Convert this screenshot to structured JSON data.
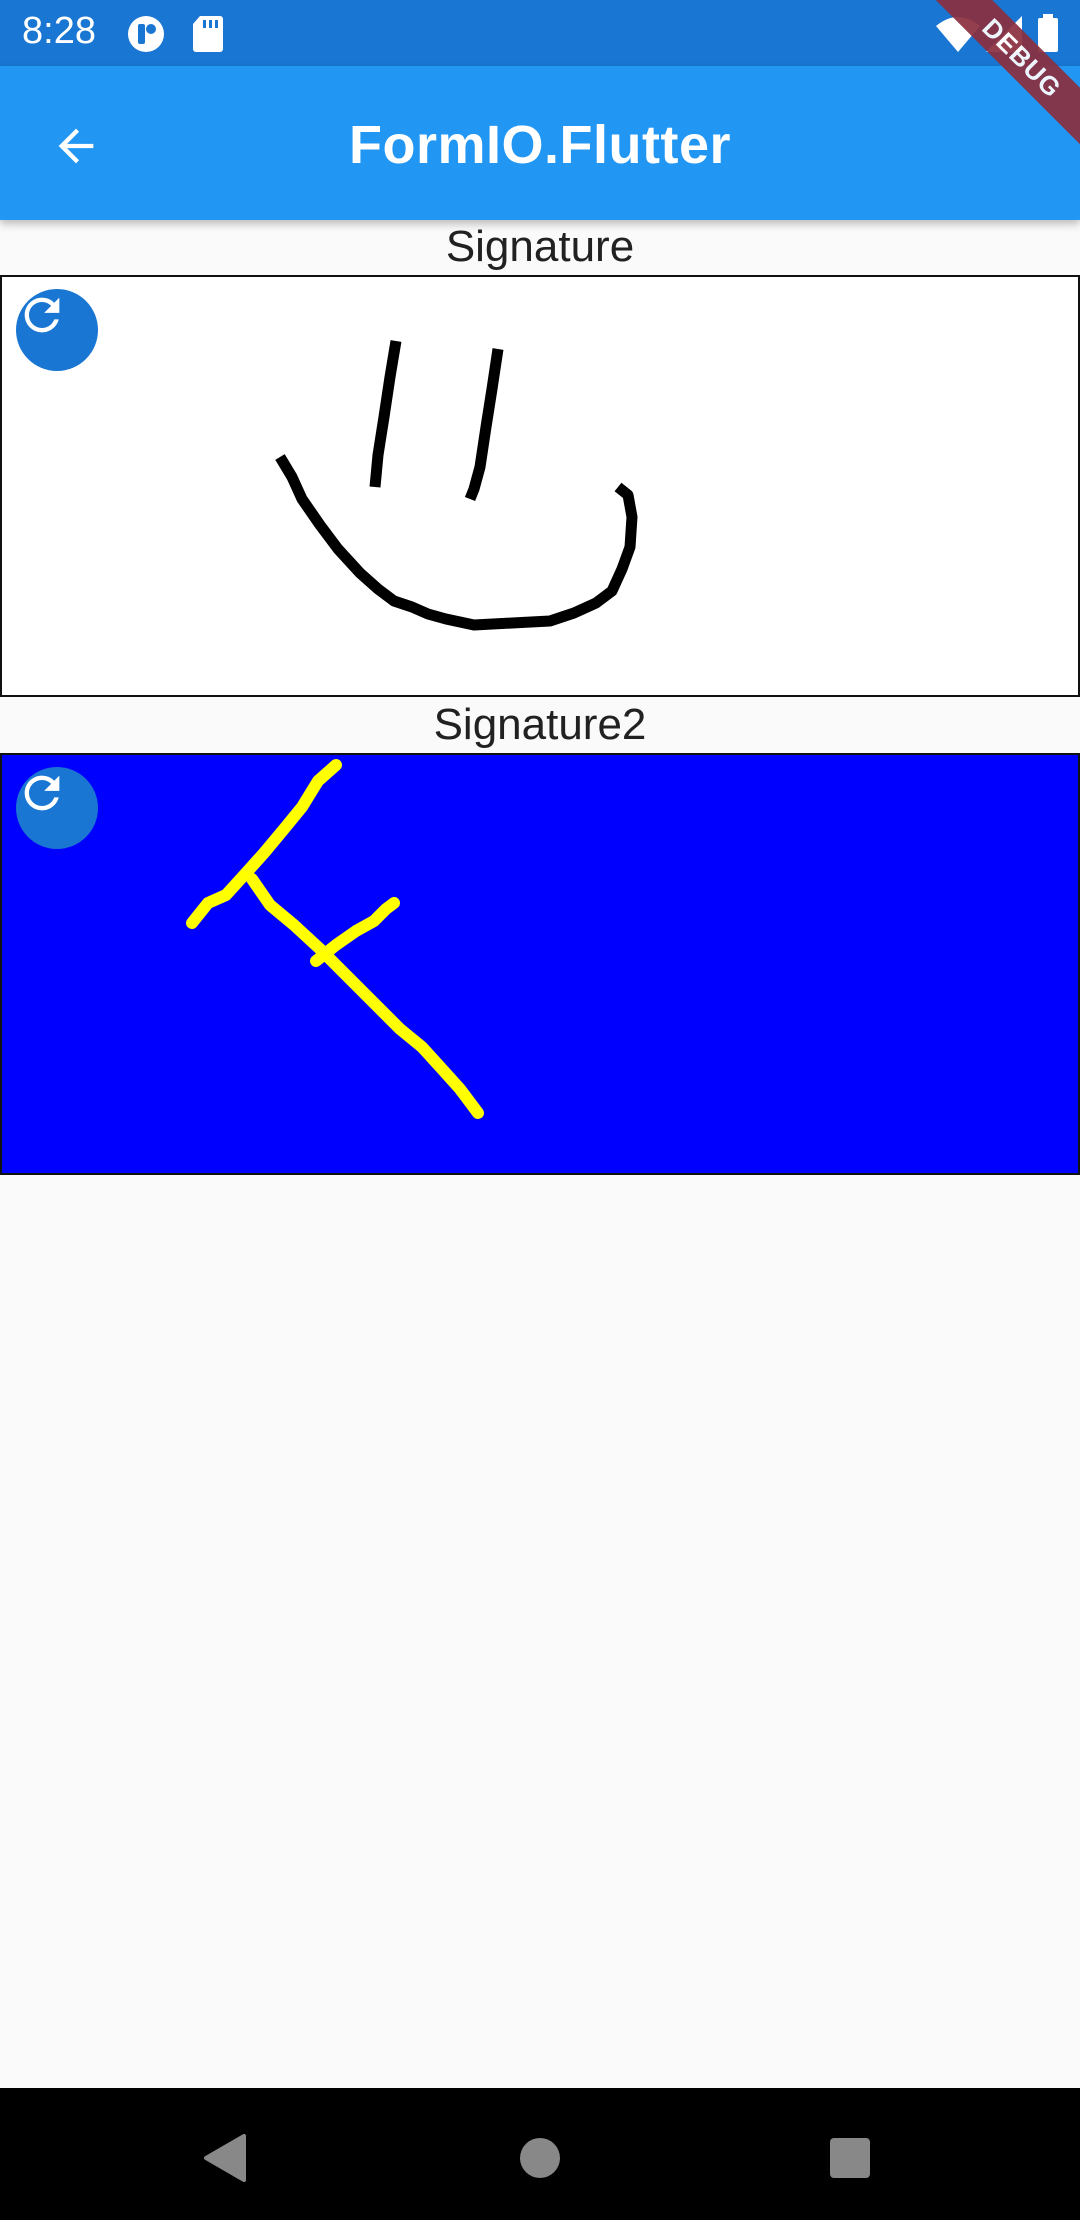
{
  "status_bar": {
    "time": "8:28",
    "icons": [
      "profile-icon",
      "sd-card-icon",
      "wifi-icon",
      "signal-icon",
      "battery-icon"
    ]
  },
  "app_bar": {
    "title": "FormIO.Flutter",
    "back_icon": "arrow-back-icon"
  },
  "debug_banner": "DEBUG",
  "signature1": {
    "label": "Signature",
    "background": "#FFFFFF",
    "stroke_color": "#000000",
    "clear_icon": "refresh-icon"
  },
  "signature2": {
    "label": "Signature2",
    "background": "#0000FF",
    "stroke_color": "#FFFF00",
    "clear_icon": "refresh-icon"
  },
  "nav_bar": {
    "icons": [
      "back-triangle-icon",
      "home-circle-icon",
      "recents-square-icon"
    ]
  },
  "colors": {
    "status_bar": "#1976D2",
    "app_bar": "#2196F3",
    "clear_button": "#1976D2",
    "background": "#FAFAFA"
  }
}
